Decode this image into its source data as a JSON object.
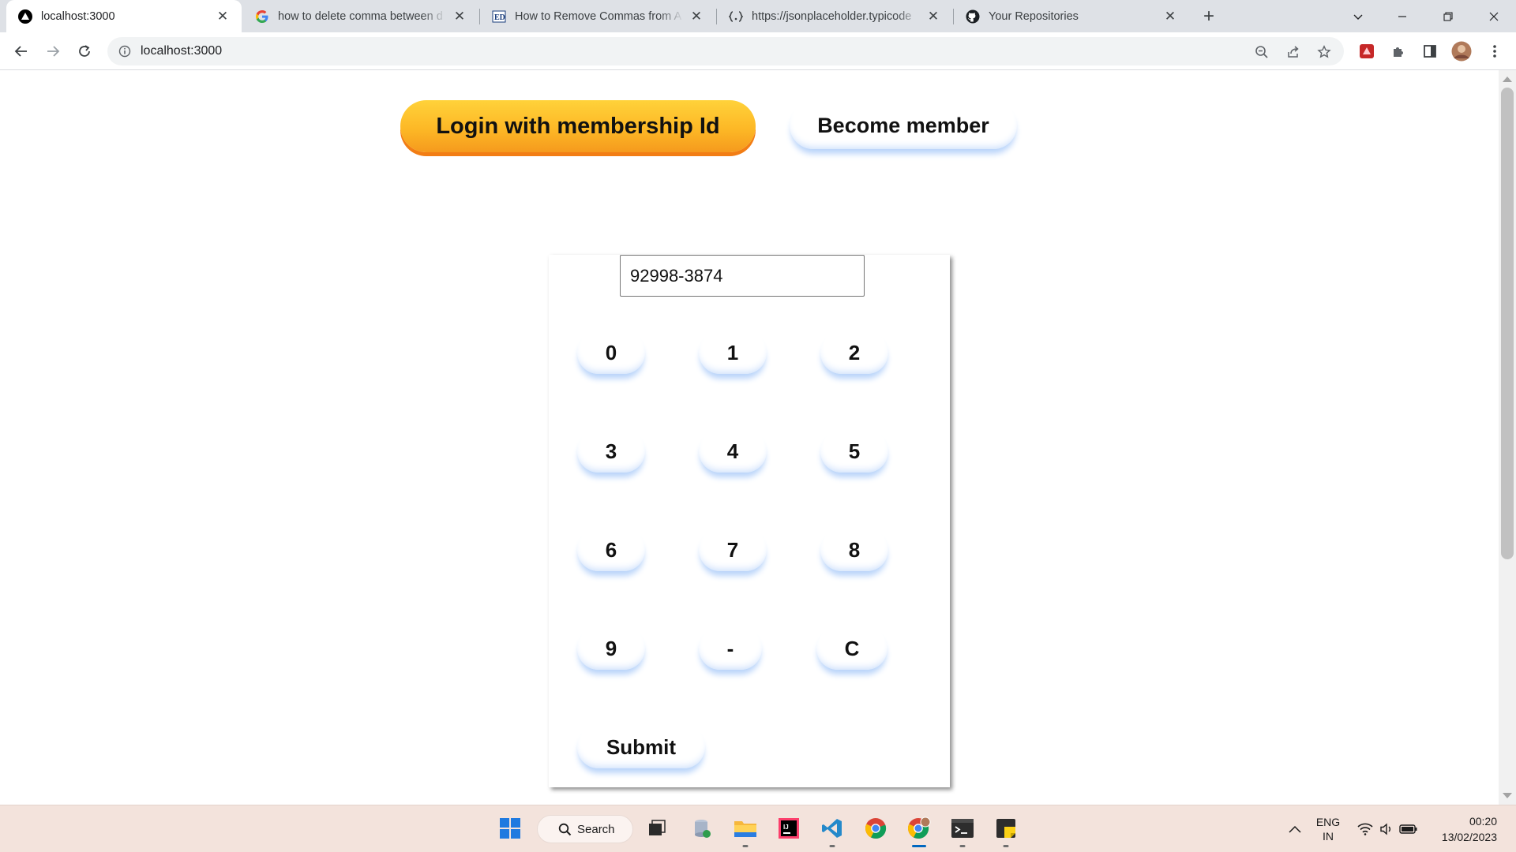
{
  "browser": {
    "tabs": [
      {
        "title": "localhost:3000",
        "icon": "nextjs-icon",
        "active": true
      },
      {
        "title": "how to delete comma between d",
        "icon": "google-icon",
        "active": false
      },
      {
        "title": "How to Remove Commas from A",
        "icon": "educba-icon",
        "active": false
      },
      {
        "title": "https://jsonplaceholder.typicode",
        "icon": "jsonplaceholder-icon",
        "active": false
      },
      {
        "title": "Your Repositories",
        "icon": "github-icon",
        "active": false
      }
    ],
    "url": "localhost:3000"
  },
  "page": {
    "login_button": "Login with membership Id",
    "member_button": "Become member",
    "membership_input_value": "92998-3874",
    "keys": [
      [
        "0",
        "1",
        "2"
      ],
      [
        "3",
        "4",
        "5"
      ],
      [
        "6",
        "7",
        "8"
      ],
      [
        "9",
        "-",
        "C"
      ]
    ],
    "submit_button": "Submit"
  },
  "taskbar": {
    "search_label": "Search",
    "language": "ENG",
    "region": "IN",
    "time": "00:20",
    "date": "13/02/2023"
  },
  "colors": {
    "login_button": "#fdb826",
    "key_glow": "#b9d4fa",
    "tabstrip": "#dee1e6",
    "taskbar": "#f3e3dc"
  }
}
